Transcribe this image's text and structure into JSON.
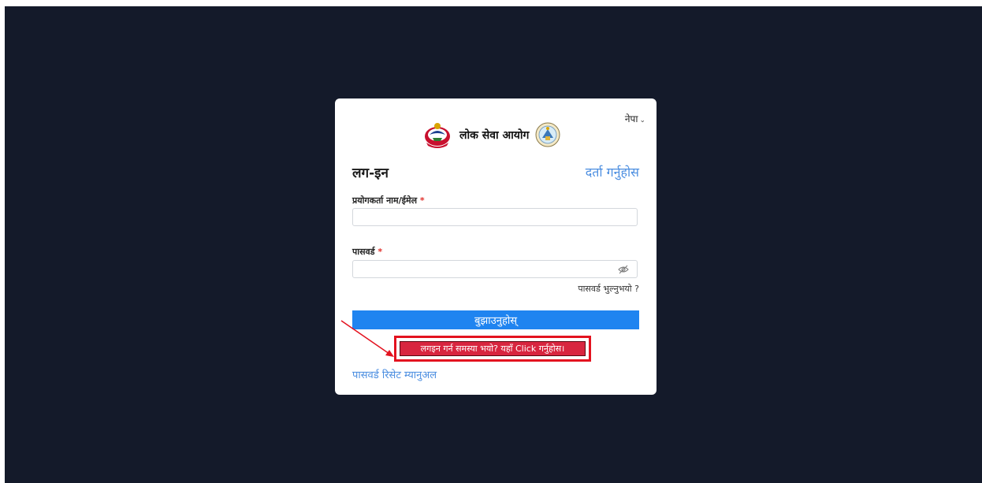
{
  "brand": {
    "name": "लोक सेवा आयोग"
  },
  "language": {
    "selected": "नेपा"
  },
  "form": {
    "title": "लग-इन",
    "register_link": "दर्ता गर्नुहोस",
    "username_label": "प्रयोगकर्ता नाम/ईमेल",
    "username_value": "",
    "password_label": "पासवर्ड",
    "password_value": "",
    "required_mark": "*",
    "forgot_password": "पासवर्ड भुल्नुभयो ?",
    "submit_label": "बुझाउनुहोस्",
    "help_label": "लगइन गर्न समस्या भयो? यहाँ Click गर्नुहोस।",
    "manual_link": "पासवर्ड रिसेट म्यानुअल"
  },
  "colors": {
    "backdrop": "#141a2a",
    "submit": "#1f84f0",
    "help": "#d8253f",
    "annotation": "#e3121f",
    "link": "#4a8de0"
  },
  "icons": {
    "language_chevron": "chevron-down-icon",
    "password_toggle": "eye-slash-icon",
    "emblem": "nepal-emblem-icon",
    "seal": "psc-seal-icon"
  }
}
